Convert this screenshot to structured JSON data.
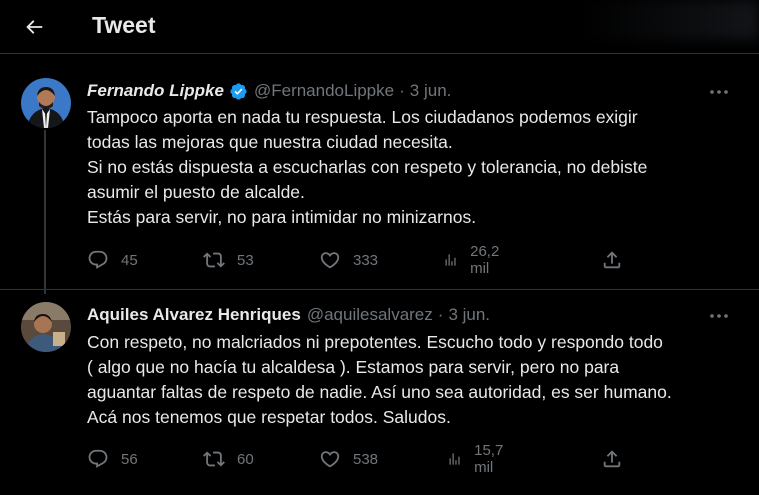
{
  "header": {
    "title": "Tweet"
  },
  "tweets": [
    {
      "display_name": "Fernando Lippke",
      "verified": true,
      "handle": "@FernandoLippke",
      "separator": "·",
      "date": "3 jun.",
      "lines": [
        "Tampoco aporta en nada tu respuesta. Los ciudadanos podemos exigir",
        "todas las mejoras que nuestra ciudad necesita.",
        "Si no estás dispuesta a escucharlas con respeto y tolerancia, no debiste",
        "asumir el puesto de alcalde.",
        "Estás para servir, no para intimidar no minizarnos."
      ],
      "replies": "45",
      "retweets": "53",
      "likes": "333",
      "views": "26,2 mil"
    },
    {
      "display_name": "Aquiles Alvarez Henriques",
      "verified": false,
      "handle": "@aquilesalvarez",
      "separator": "·",
      "date": "3 jun.",
      "lines": [
        "Con respeto, no malcriados ni prepotentes. Escucho todo y respondo todo",
        "( algo que no hacía tu alcaldesa ). Estamos para servir, pero no para",
        "aguantar faltas de respeto de nadie. Así uno sea autoridad, es ser humano.",
        "Acá nos tenemos que respetar todos. Saludos."
      ],
      "replies": "56",
      "retweets": "60",
      "likes": "538",
      "views": "15,7 mil"
    }
  ],
  "colors": {
    "background": "#000000",
    "text": "#e7e9ea",
    "muted": "#71767b",
    "verified": "#1d9bf0"
  },
  "icons": [
    "back-arrow-icon",
    "verified-badge-icon",
    "more-icon",
    "reply-icon",
    "retweet-icon",
    "like-icon",
    "views-icon",
    "share-icon"
  ]
}
